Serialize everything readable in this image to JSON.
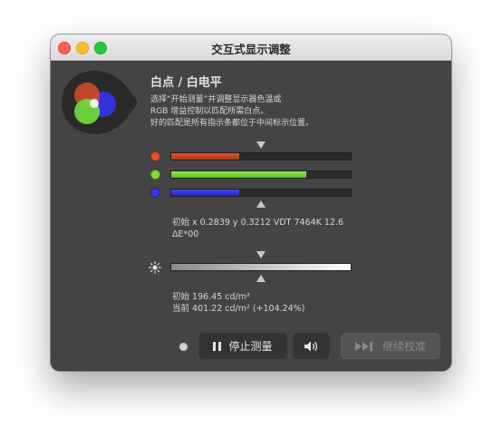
{
  "window": {
    "title": "交互式显示调整"
  },
  "section": {
    "heading": "白点 / 白电平",
    "description": [
      "选择“开始测量”并调整显示器色温或",
      "RGB 增益控制以匹配所需白点。",
      "好的匹配是所有指示条都位于中间标示位置。"
    ]
  },
  "rgb_bars": [
    {
      "name": "red",
      "color": "#e0542c",
      "level": 0.38
    },
    {
      "name": "green",
      "color": "#7ee03a",
      "level": 0.75
    },
    {
      "name": "blue",
      "color": "#3a3ae6",
      "level": 0.38
    }
  ],
  "white_point_readout": {
    "line1": "初始 x 0.2839 y 0.3212 VDT 7464K 12.6",
    "line2": "ΔE*00"
  },
  "luminance_bar": {
    "level": 1.0
  },
  "luminance_readout": {
    "initial": "初始 196.45 cd/m²",
    "current": "当前 401.22 cd/m² (+104.24%)"
  },
  "buttons": {
    "stop_label": "停止测量",
    "continue_label": "继续校准"
  },
  "icons": {
    "pause": "pause-icon",
    "speaker": "speaker-icon",
    "skip": "skip-forward-icon",
    "brightness": "sun-icon",
    "logo": "rgb-circles-icon"
  }
}
